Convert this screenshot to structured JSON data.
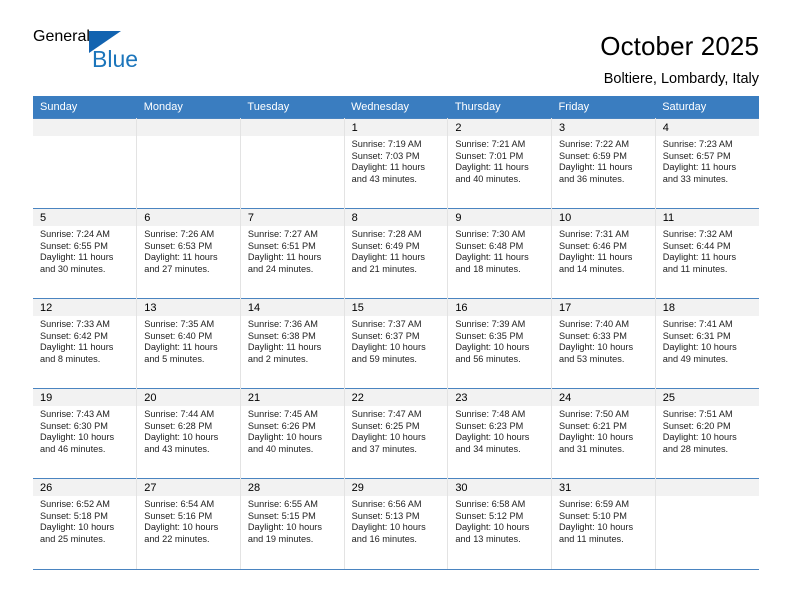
{
  "brand": {
    "name_top": "General",
    "name_bottom": "Blue",
    "triangle_color": "#1263b0",
    "blue_text_color": "#1b75bb"
  },
  "header": {
    "title": "October 2025",
    "subtitle": "Boltiere, Lombardy, Italy"
  },
  "theme": {
    "header_row_bg": "#3a7dc0",
    "grid_line": "#4a84c0",
    "daynum_band_bg": "#f2f2f2"
  },
  "weekday_headers": [
    "Sunday",
    "Monday",
    "Tuesday",
    "Wednesday",
    "Thursday",
    "Friday",
    "Saturday"
  ],
  "weeks": [
    [
      {
        "day": "",
        "sunrise": "",
        "sunset": "",
        "daylight_line1": "",
        "daylight_line2": "",
        "empty": true
      },
      {
        "day": "",
        "sunrise": "",
        "sunset": "",
        "daylight_line1": "",
        "daylight_line2": "",
        "empty": true
      },
      {
        "day": "",
        "sunrise": "",
        "sunset": "",
        "daylight_line1": "",
        "daylight_line2": "",
        "empty": true
      },
      {
        "day": "1",
        "sunrise": "Sunrise: 7:19 AM",
        "sunset": "Sunset: 7:03 PM",
        "daylight_line1": "Daylight: 11 hours",
        "daylight_line2": "and 43 minutes."
      },
      {
        "day": "2",
        "sunrise": "Sunrise: 7:21 AM",
        "sunset": "Sunset: 7:01 PM",
        "daylight_line1": "Daylight: 11 hours",
        "daylight_line2": "and 40 minutes."
      },
      {
        "day": "3",
        "sunrise": "Sunrise: 7:22 AM",
        "sunset": "Sunset: 6:59 PM",
        "daylight_line1": "Daylight: 11 hours",
        "daylight_line2": "and 36 minutes."
      },
      {
        "day": "4",
        "sunrise": "Sunrise: 7:23 AM",
        "sunset": "Sunset: 6:57 PM",
        "daylight_line1": "Daylight: 11 hours",
        "daylight_line2": "and 33 minutes."
      }
    ],
    [
      {
        "day": "5",
        "sunrise": "Sunrise: 7:24 AM",
        "sunset": "Sunset: 6:55 PM",
        "daylight_line1": "Daylight: 11 hours",
        "daylight_line2": "and 30 minutes."
      },
      {
        "day": "6",
        "sunrise": "Sunrise: 7:26 AM",
        "sunset": "Sunset: 6:53 PM",
        "daylight_line1": "Daylight: 11 hours",
        "daylight_line2": "and 27 minutes."
      },
      {
        "day": "7",
        "sunrise": "Sunrise: 7:27 AM",
        "sunset": "Sunset: 6:51 PM",
        "daylight_line1": "Daylight: 11 hours",
        "daylight_line2": "and 24 minutes."
      },
      {
        "day": "8",
        "sunrise": "Sunrise: 7:28 AM",
        "sunset": "Sunset: 6:49 PM",
        "daylight_line1": "Daylight: 11 hours",
        "daylight_line2": "and 21 minutes."
      },
      {
        "day": "9",
        "sunrise": "Sunrise: 7:30 AM",
        "sunset": "Sunset: 6:48 PM",
        "daylight_line1": "Daylight: 11 hours",
        "daylight_line2": "and 18 minutes."
      },
      {
        "day": "10",
        "sunrise": "Sunrise: 7:31 AM",
        "sunset": "Sunset: 6:46 PM",
        "daylight_line1": "Daylight: 11 hours",
        "daylight_line2": "and 14 minutes."
      },
      {
        "day": "11",
        "sunrise": "Sunrise: 7:32 AM",
        "sunset": "Sunset: 6:44 PM",
        "daylight_line1": "Daylight: 11 hours",
        "daylight_line2": "and 11 minutes."
      }
    ],
    [
      {
        "day": "12",
        "sunrise": "Sunrise: 7:33 AM",
        "sunset": "Sunset: 6:42 PM",
        "daylight_line1": "Daylight: 11 hours",
        "daylight_line2": "and 8 minutes."
      },
      {
        "day": "13",
        "sunrise": "Sunrise: 7:35 AM",
        "sunset": "Sunset: 6:40 PM",
        "daylight_line1": "Daylight: 11 hours",
        "daylight_line2": "and 5 minutes."
      },
      {
        "day": "14",
        "sunrise": "Sunrise: 7:36 AM",
        "sunset": "Sunset: 6:38 PM",
        "daylight_line1": "Daylight: 11 hours",
        "daylight_line2": "and 2 minutes."
      },
      {
        "day": "15",
        "sunrise": "Sunrise: 7:37 AM",
        "sunset": "Sunset: 6:37 PM",
        "daylight_line1": "Daylight: 10 hours",
        "daylight_line2": "and 59 minutes."
      },
      {
        "day": "16",
        "sunrise": "Sunrise: 7:39 AM",
        "sunset": "Sunset: 6:35 PM",
        "daylight_line1": "Daylight: 10 hours",
        "daylight_line2": "and 56 minutes."
      },
      {
        "day": "17",
        "sunrise": "Sunrise: 7:40 AM",
        "sunset": "Sunset: 6:33 PM",
        "daylight_line1": "Daylight: 10 hours",
        "daylight_line2": "and 53 minutes."
      },
      {
        "day": "18",
        "sunrise": "Sunrise: 7:41 AM",
        "sunset": "Sunset: 6:31 PM",
        "daylight_line1": "Daylight: 10 hours",
        "daylight_line2": "and 49 minutes."
      }
    ],
    [
      {
        "day": "19",
        "sunrise": "Sunrise: 7:43 AM",
        "sunset": "Sunset: 6:30 PM",
        "daylight_line1": "Daylight: 10 hours",
        "daylight_line2": "and 46 minutes."
      },
      {
        "day": "20",
        "sunrise": "Sunrise: 7:44 AM",
        "sunset": "Sunset: 6:28 PM",
        "daylight_line1": "Daylight: 10 hours",
        "daylight_line2": "and 43 minutes."
      },
      {
        "day": "21",
        "sunrise": "Sunrise: 7:45 AM",
        "sunset": "Sunset: 6:26 PM",
        "daylight_line1": "Daylight: 10 hours",
        "daylight_line2": "and 40 minutes."
      },
      {
        "day": "22",
        "sunrise": "Sunrise: 7:47 AM",
        "sunset": "Sunset: 6:25 PM",
        "daylight_line1": "Daylight: 10 hours",
        "daylight_line2": "and 37 minutes."
      },
      {
        "day": "23",
        "sunrise": "Sunrise: 7:48 AM",
        "sunset": "Sunset: 6:23 PM",
        "daylight_line1": "Daylight: 10 hours",
        "daylight_line2": "and 34 minutes."
      },
      {
        "day": "24",
        "sunrise": "Sunrise: 7:50 AM",
        "sunset": "Sunset: 6:21 PM",
        "daylight_line1": "Daylight: 10 hours",
        "daylight_line2": "and 31 minutes."
      },
      {
        "day": "25",
        "sunrise": "Sunrise: 7:51 AM",
        "sunset": "Sunset: 6:20 PM",
        "daylight_line1": "Daylight: 10 hours",
        "daylight_line2": "and 28 minutes."
      }
    ],
    [
      {
        "day": "26",
        "sunrise": "Sunrise: 6:52 AM",
        "sunset": "Sunset: 5:18 PM",
        "daylight_line1": "Daylight: 10 hours",
        "daylight_line2": "and 25 minutes."
      },
      {
        "day": "27",
        "sunrise": "Sunrise: 6:54 AM",
        "sunset": "Sunset: 5:16 PM",
        "daylight_line1": "Daylight: 10 hours",
        "daylight_line2": "and 22 minutes."
      },
      {
        "day": "28",
        "sunrise": "Sunrise: 6:55 AM",
        "sunset": "Sunset: 5:15 PM",
        "daylight_line1": "Daylight: 10 hours",
        "daylight_line2": "and 19 minutes."
      },
      {
        "day": "29",
        "sunrise": "Sunrise: 6:56 AM",
        "sunset": "Sunset: 5:13 PM",
        "daylight_line1": "Daylight: 10 hours",
        "daylight_line2": "and 16 minutes."
      },
      {
        "day": "30",
        "sunrise": "Sunrise: 6:58 AM",
        "sunset": "Sunset: 5:12 PM",
        "daylight_line1": "Daylight: 10 hours",
        "daylight_line2": "and 13 minutes."
      },
      {
        "day": "31",
        "sunrise": "Sunrise: 6:59 AM",
        "sunset": "Sunset: 5:10 PM",
        "daylight_line1": "Daylight: 10 hours",
        "daylight_line2": "and 11 minutes."
      },
      {
        "day": "",
        "sunrise": "",
        "sunset": "",
        "daylight_line1": "",
        "daylight_line2": "",
        "empty": true
      }
    ]
  ]
}
